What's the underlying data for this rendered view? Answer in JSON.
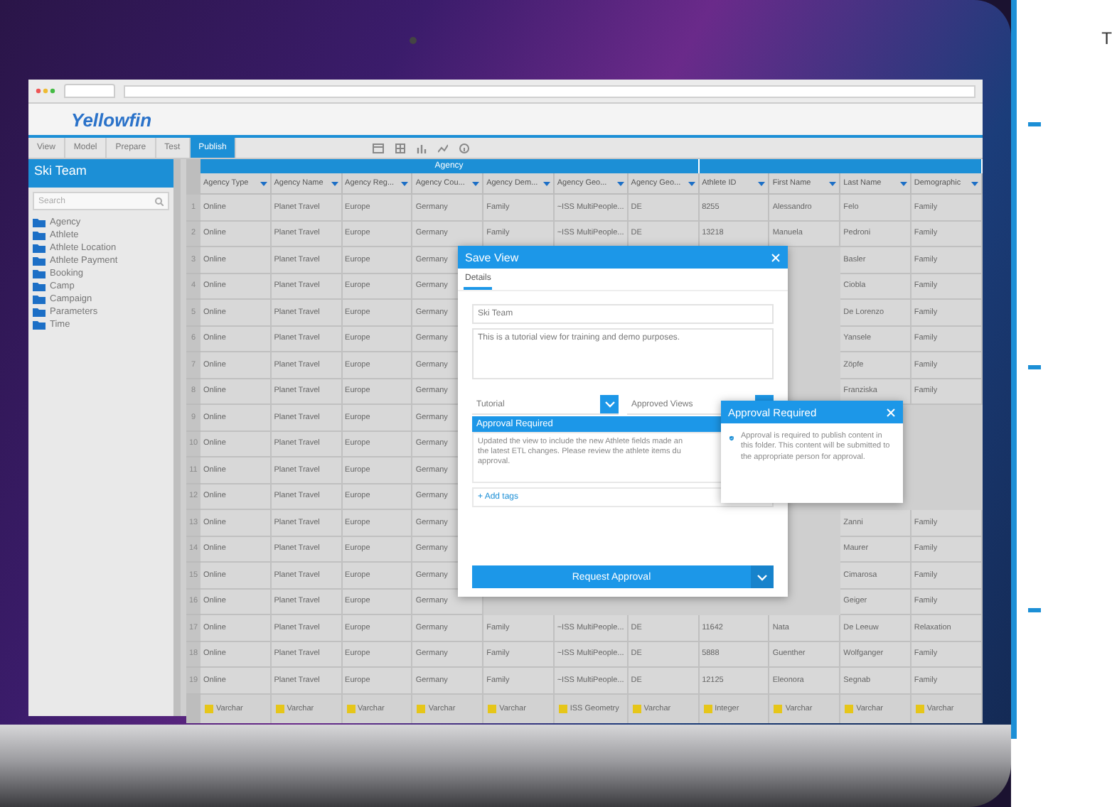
{
  "app": {
    "logo": "Yellowfin",
    "nav_tabs": [
      {
        "label": "View",
        "selected": false
      },
      {
        "label": "Model",
        "selected": false
      },
      {
        "label": "Prepare",
        "selected": false
      },
      {
        "label": "Test",
        "selected": false
      },
      {
        "label": "Publish",
        "selected": true
      }
    ]
  },
  "sidebar": {
    "title": "Ski Team",
    "search": {
      "placeholder": "Search"
    },
    "items": [
      "Agency",
      "Athlete",
      "Athlete Location",
      "Athlete Payment",
      "Booking",
      "Camp",
      "Campaign",
      "Parameters",
      "Time"
    ]
  },
  "table": {
    "groups": [
      {
        "label": "Agency",
        "columns": [
          "Agency Type",
          "Agency Name",
          "Agency Reg...",
          "Agency Cou...",
          "Agency Dem...",
          "Agency Geo...",
          "Agency Geo..."
        ]
      },
      {
        "columns": [
          "Athlete ID",
          "First Name",
          "Last Name",
          "Demographic"
        ]
      }
    ],
    "rows": [
      {
        "number": "1",
        "cells": [
          "Online",
          "Planet Travel",
          "Europe",
          "Germany",
          "Family",
          "~ISS MultiPeople...",
          "DE",
          "8255",
          "Alessandro",
          "Felo",
          "Family"
        ]
      },
      {
        "number": "2",
        "cells": [
          "Online",
          "Planet Travel",
          "Europe",
          "Germany",
          "Family",
          "~ISS MultiPeople...",
          "DE",
          "13218",
          "Manuela",
          "Pedroni",
          "Family"
        ]
      },
      {
        "number": "3",
        "cells": [
          "Online",
          "Planet Travel",
          "Europe",
          "Germany",
          null,
          null,
          null,
          null,
          null,
          "Basler",
          "Family"
        ]
      },
      {
        "number": "4",
        "cells": [
          "Online",
          "Planet Travel",
          "Europe",
          "Germany",
          null,
          null,
          null,
          null,
          null,
          "Ciobla",
          "Family"
        ]
      },
      {
        "number": "5",
        "cells": [
          "Online",
          "Planet Travel",
          "Europe",
          "Germany",
          null,
          null,
          null,
          null,
          null,
          "De Lorenzo",
          "Family"
        ]
      },
      {
        "number": "6",
        "cells": [
          "Online",
          "Planet Travel",
          "Europe",
          "Germany",
          null,
          null,
          null,
          null,
          null,
          "Yansele",
          "Family"
        ]
      },
      {
        "number": "7",
        "cells": [
          "Online",
          "Planet Travel",
          "Europe",
          "Germany",
          null,
          null,
          null,
          null,
          null,
          "Zöpfe",
          "Family"
        ]
      },
      {
        "number": "8",
        "cells": [
          "Online",
          "Planet Travel",
          "Europe",
          "Germany",
          null,
          null,
          null,
          null,
          null,
          "Franziska",
          "Family"
        ]
      },
      {
        "number": "9",
        "cells": [
          "Online",
          "Planet Travel",
          "Europe",
          "Germany",
          null,
          null,
          null,
          null,
          null,
          null,
          null
        ]
      },
      {
        "number": "10",
        "cells": [
          "Online",
          "Planet Travel",
          "Europe",
          "Germany",
          null,
          null,
          null,
          null,
          null,
          null,
          null
        ]
      },
      {
        "number": "11",
        "cells": [
          "Online",
          "Planet Travel",
          "Europe",
          "Germany",
          null,
          null,
          null,
          null,
          null,
          null,
          null
        ]
      },
      {
        "number": "12",
        "cells": [
          "Online",
          "Planet Travel",
          "Europe",
          "Germany",
          null,
          null,
          null,
          null,
          null,
          null,
          null
        ]
      },
      {
        "number": "13",
        "cells": [
          "Online",
          "Planet Travel",
          "Europe",
          "Germany",
          null,
          null,
          null,
          null,
          null,
          "Zanni",
          "Family"
        ]
      },
      {
        "number": "14",
        "cells": [
          "Online",
          "Planet Travel",
          "Europe",
          "Germany",
          null,
          null,
          null,
          null,
          null,
          "Maurer",
          "Family"
        ]
      },
      {
        "number": "15",
        "cells": [
          "Online",
          "Planet Travel",
          "Europe",
          "Germany",
          null,
          null,
          null,
          null,
          null,
          "Cimarosa",
          "Family"
        ]
      },
      {
        "number": "16",
        "cells": [
          "Online",
          "Planet Travel",
          "Europe",
          "Germany",
          null,
          null,
          null,
          null,
          null,
          "Geiger",
          "Family"
        ]
      },
      {
        "number": "17",
        "cells": [
          "Online",
          "Planet Travel",
          "Europe",
          "Germany",
          "Family",
          "~ISS MultiPeople...",
          "DE",
          "11642",
          "Nata",
          "De Leeuw",
          "Relaxation"
        ]
      },
      {
        "number": "18",
        "cells": [
          "Online",
          "Planet Travel",
          "Europe",
          "Germany",
          "Family",
          "~ISS MultiPeople...",
          "DE",
          "5888",
          "Guenther",
          "Wolfganger",
          "Family"
        ]
      },
      {
        "number": "19",
        "cells": [
          "Online",
          "Planet Travel",
          "Europe",
          "Germany",
          "Family",
          "~ISS MultiPeople...",
          "DE",
          "12125",
          "Eleonora",
          "Segnab",
          "Family"
        ]
      }
    ],
    "types": [
      "Varchar",
      "Varchar",
      "Varchar",
      "Varchar",
      "Varchar",
      "ISS Geometry",
      "Varchar",
      "Integer",
      "Varchar",
      "Varchar",
      "Varchar"
    ]
  },
  "dialog": {
    "title": "Save View",
    "tabs": [
      {
        "label": "Details",
        "selected": true
      }
    ],
    "name_field": {
      "value": "Ski Team"
    },
    "description": {
      "value": "This is a tutorial view for training and demo purposes."
    },
    "category": {
      "value": "Tutorial"
    },
    "subfolder": {
      "value": "Approved Views"
    },
    "approval": {
      "title": "Approval Required",
      "note_lines": [
        "Updated the view to include the new Athlete fields made an",
        "the latest ETL changes. Please review the athlete items du",
        "approval."
      ]
    },
    "tags_link": "+ Add tags",
    "submit": "Request Approval"
  },
  "popup": {
    "title": "Approval Required",
    "message": "Approval is required to publish content in this folder. This content will be submitted to the appropriate person for approval."
  },
  "side_panel": {
    "heading": "T"
  }
}
